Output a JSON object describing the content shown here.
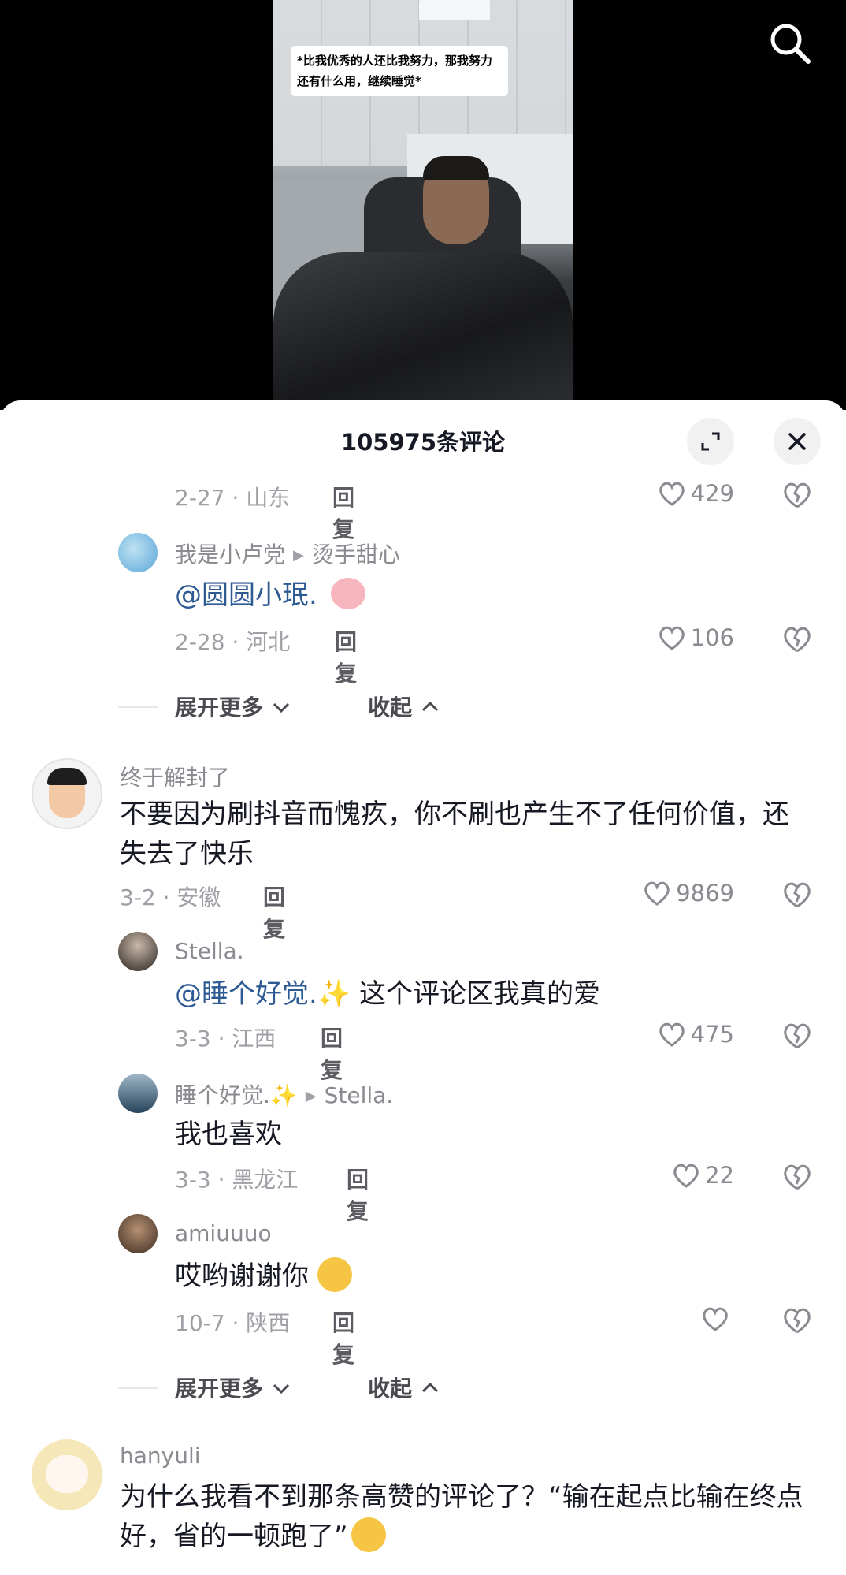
{
  "video": {
    "caption": "*比我优秀的人还比我努力，那我努力还有什么用，继续睡觉*"
  },
  "sheet": {
    "title": "105975条评论"
  },
  "comments": [
    {
      "meta": "2-27 · 山东",
      "reply": "回复",
      "likes": "429"
    },
    {
      "user": "我是小卢党",
      "reply_to": "烫手甜心",
      "mention": "@圆圆小珉.",
      "text": "",
      "meta": "2-28 · 河北",
      "reply": "回复",
      "likes": "106"
    },
    {
      "user": "终于解封了",
      "text": "不要因为刷抖音而愧疚，你不刷也产生不了任何价值，还失去了快乐",
      "meta": "3-2 · 安徽",
      "reply": "回复",
      "likes": "9869"
    },
    {
      "user": "Stella.",
      "mention": "@睡个好觉.✨",
      "text": " 这个评论区我真的爱",
      "meta": "3-3 · 江西",
      "reply": "回复",
      "likes": "475"
    },
    {
      "user": "睡个好觉.✨",
      "reply_to": "Stella.",
      "text": "我也喜欢",
      "meta": "3-3 · 黑龙江",
      "reply": "回复",
      "likes": "22"
    },
    {
      "user": "amiuuuo",
      "text": "哎哟谢谢你",
      "meta": "10-7 · 陕西",
      "reply": "回复",
      "likes": ""
    },
    {
      "user": "hanyuli",
      "text": "为什么我看不到那条高赞的评论了？“输在起点比输在终点好，省的一顿跑了”"
    }
  ],
  "expand": {
    "more": "展开更多",
    "collapse": "收起"
  },
  "icons": {
    "search": "search-icon",
    "fullscreen": "expand-icon",
    "close": "close-icon",
    "like": "heart-icon",
    "dislike": "broken-heart-icon"
  }
}
